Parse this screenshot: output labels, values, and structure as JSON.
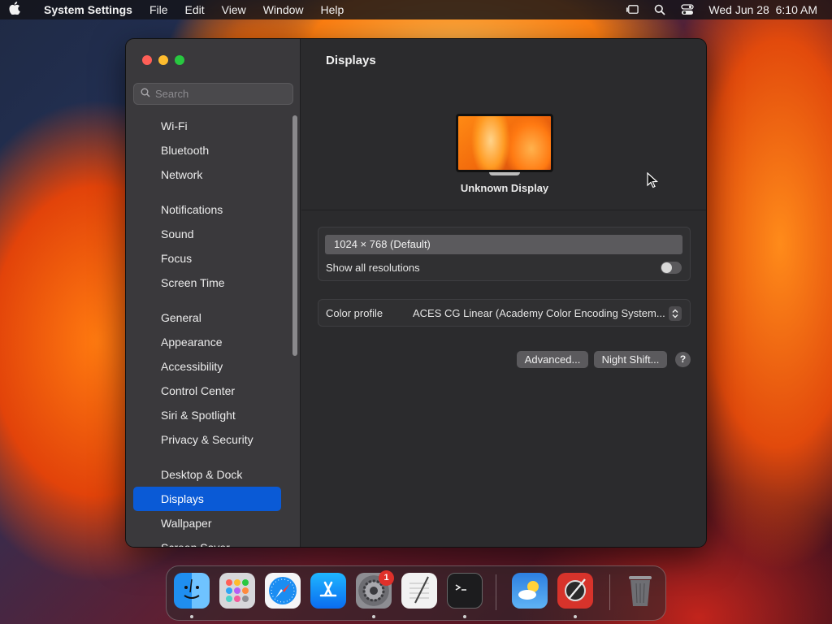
{
  "menubar": {
    "app_name": "System Settings",
    "menus": [
      "File",
      "Edit",
      "View",
      "Window",
      "Help"
    ],
    "clock": "Wed Jun 28  6:10 AM"
  },
  "sidebar": {
    "search_placeholder": "Search",
    "items": [
      {
        "label": "Wi-Fi"
      },
      {
        "label": "Bluetooth"
      },
      {
        "label": "Network"
      },
      {
        "label": "Notifications"
      },
      {
        "label": "Sound"
      },
      {
        "label": "Focus"
      },
      {
        "label": "Screen Time"
      },
      {
        "label": "General"
      },
      {
        "label": "Appearance"
      },
      {
        "label": "Accessibility"
      },
      {
        "label": "Control Center"
      },
      {
        "label": "Siri & Spotlight"
      },
      {
        "label": "Privacy & Security"
      },
      {
        "label": "Desktop & Dock"
      },
      {
        "label": "Displays"
      },
      {
        "label": "Wallpaper"
      },
      {
        "label": "Screen Saver"
      }
    ],
    "active_item": "Displays"
  },
  "main": {
    "title": "Displays",
    "display_name": "Unknown Display",
    "resolution": "1024 × 768 (Default)",
    "show_all_resolutions_label": "Show all resolutions",
    "show_all_resolutions_on": false,
    "color_profile_label": "Color profile",
    "color_profile_value": "ACES CG Linear (Academy Color Encoding System...",
    "advanced_button": "Advanced...",
    "night_shift_button": "Night Shift...",
    "help_button": "?"
  },
  "dock": {
    "items": [
      "finder-icon",
      "launchpad-icon",
      "safari-icon",
      "app-store-icon",
      "system-settings-icon",
      "textedit-icon",
      "terminal-icon",
      "weather-icon",
      "instruments-icon",
      "trash-icon"
    ],
    "system_settings_badge": "1"
  },
  "colors": {
    "accent": "#0a5ad6",
    "window_bg": "#2b2b2d",
    "sidebar_bg": "#3a393c",
    "badge": "#e0302a"
  }
}
